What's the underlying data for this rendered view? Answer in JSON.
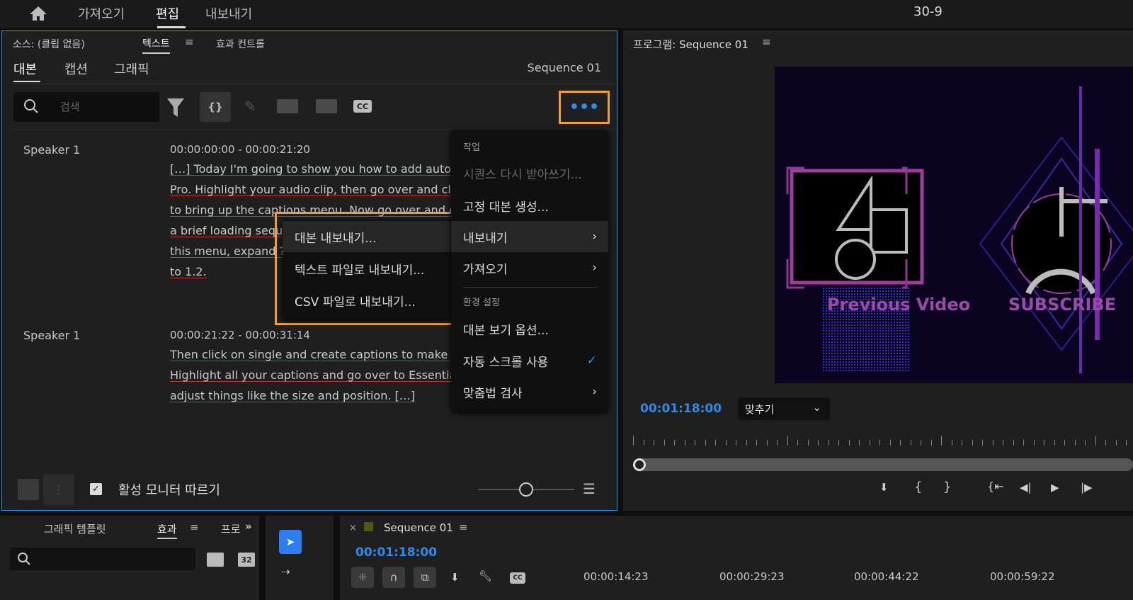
{
  "topbar": {
    "nav": [
      "가져오기",
      "편집",
      "내보내기"
    ],
    "project_title": "30-9"
  },
  "source_panel": {
    "tabs": [
      "소스: (클립 없음)",
      "텍스트",
      "효과 컨트롤"
    ],
    "subtabs": [
      "대본",
      "캡션",
      "그래픽"
    ],
    "sequence_name": "Sequence 01",
    "search_placeholder": "검색",
    "entries": [
      {
        "speaker": "Speaker 1",
        "timecode": "00:00:00:00 - 00:00:21:20",
        "lines": [
          "[…] Today I'm going to show you how to add automa",
          "Pro. Highlight your audio clip, then go over and click c",
          "to bring up the captions menu. Now go over and click",
          "a brief loading seque",
          "this menu, expand ?",
          "to 1.2."
        ]
      },
      {
        "speaker": "Speaker 1",
        "timecode": "00:00:21:22 - 00:00:31:14",
        "lines": [
          "Then click on single and create captions to make char",
          "Highlight all your captions and go over to Essential Gr",
          "adjust things like the size and position. […]"
        ]
      }
    ],
    "follow_monitor_label": "활성 모니터 따르기",
    "follow_monitor_checked": true
  },
  "context_menu": {
    "header_actions": "작업",
    "items": [
      {
        "label": "시퀀스 다시 받아쓰기...",
        "disabled": true
      },
      {
        "label": "고정 대본 생성..."
      },
      {
        "label": "내보내기",
        "submenu": true,
        "active": true
      },
      {
        "label": "가져오기",
        "submenu": true
      }
    ],
    "header_prefs": "환경 설정",
    "pref_items": [
      {
        "label": "대본 보기 옵션..."
      },
      {
        "label": "자동 스크롤 사용",
        "checked": true
      },
      {
        "label": "맞춤법 검사",
        "submenu": true
      }
    ]
  },
  "export_submenu": {
    "items": [
      "대본 내보내기...",
      "텍스트 파일로 내보내기...",
      "CSV 파일로 내보내기..."
    ]
  },
  "program_panel": {
    "title": "프로그램: Sequence 01",
    "video_text": [
      "Previous Video",
      "SUBSCRIBE"
    ],
    "timecode": "00:01:18:00",
    "zoom_select": "맞추기"
  },
  "effects_panel": {
    "tabs": [
      "그래픽 템플릿",
      "효과",
      "프로"
    ]
  },
  "timeline": {
    "title": "Sequence 01",
    "timecode": "00:01:18:00",
    "ruler": [
      "00:00:14:23",
      "00:00:29:23",
      "00:00:44:22",
      "00:00:59:22"
    ]
  },
  "colors": {
    "accent_blue": "#2d8ceb",
    "highlight_orange": "#f0a030",
    "panel_border": "#3a8ee6"
  }
}
